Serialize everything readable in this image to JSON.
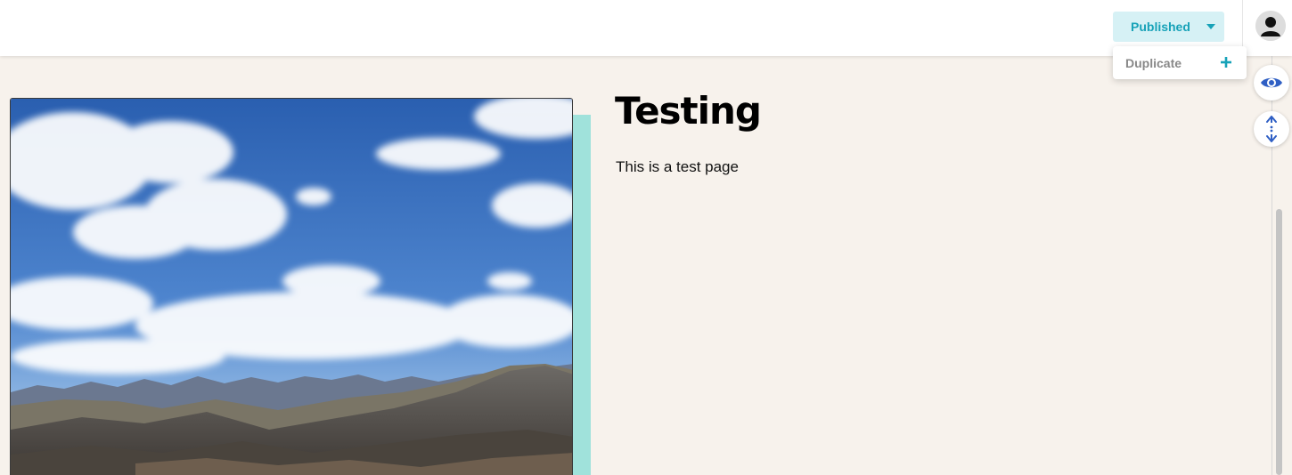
{
  "header": {
    "status_label": "Published",
    "status_icon": "chevron-down-icon",
    "avatar_icon": "user-avatar-icon"
  },
  "dropdown": {
    "items": [
      {
        "label": "Duplicate",
        "icon": "plus-icon"
      }
    ]
  },
  "page": {
    "title": "Testing",
    "body": "This is a test page",
    "hero_image": "mountain-sky-photo"
  },
  "tools": {
    "preview_icon": "eye-icon",
    "resize_icon": "vertical-resize-icon"
  },
  "colors": {
    "accent": "#17a2b8",
    "accent_light": "#d6f1f5",
    "teal_bar": "#a0e2db",
    "page_bg": "#f7f2ec",
    "tool_icon": "#2f5fc4"
  }
}
